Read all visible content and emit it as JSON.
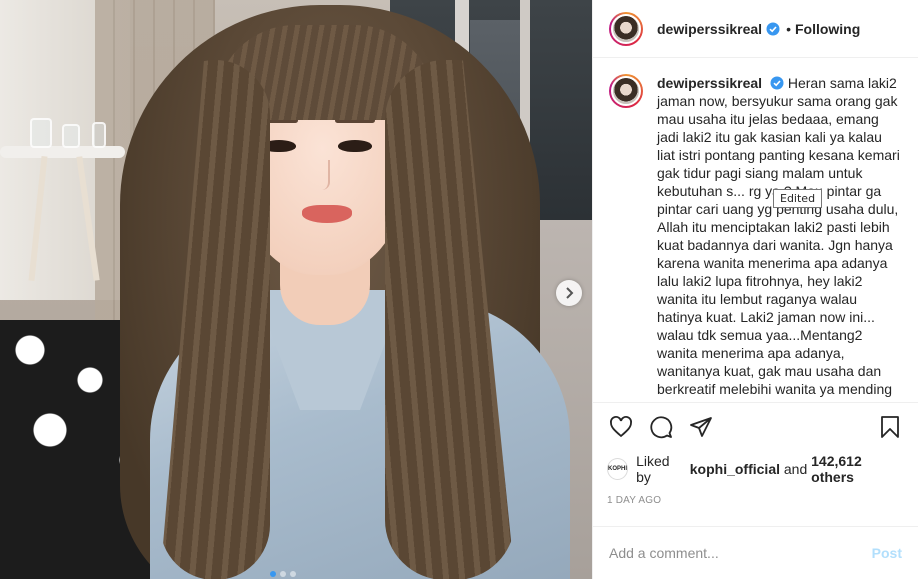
{
  "post": {
    "username": "dewiperssikreal",
    "follow_state": "Following",
    "bullet": "•",
    "caption_username": "dewiperssikreal",
    "caption": "Heran sama laki2 jaman now, bersyukur sama orang gak mau usaha itu jelas bedaaa, emang jadi laki2 itu gak kasian kali ya kalau liat istri pontang panting kesana kemari gak tidur pagi siang malam untuk kebutuhan s... rg ya ? Mau pintar ga pintar cari uang yg penting usaha dulu, Allah itu menciptakan laki2 pasti lebih kuat badannya dari wanita. Jgn hanya karena wanita menerima apa adanya lalu laki2 lupa fitrohnya, hey laki2 wanita itu lembut raganya walau hatinya kuat. Laki2 jaman now ini... walau tdk semua yaa...Mentang2 wanita menerima apa adanya, wanitanya kuat, gak mau usaha dan berkreatif melebihi wanita ya mending saran pake rok aja... gak",
    "tooltip": "Edited",
    "liked_by_prefix": "Liked by ",
    "liked_by_user": "kophi_official",
    "liked_by_middle": " and ",
    "liked_by_count": "142,612 others",
    "liker_avatar_label": "KOPHI",
    "time_ago": "1 DAY AGO",
    "comment_placeholder": "Add a comment...",
    "post_button": "Post"
  },
  "carousel": {
    "slide_count": 3,
    "active_index": 0
  },
  "icons": {
    "verified": "verified-badge-icon",
    "like": "heart-icon",
    "comment": "comment-bubble-icon",
    "share": "paper-plane-icon",
    "save": "bookmark-icon",
    "next": "chevron-right-icon"
  },
  "colors": {
    "verified": "#3897f0",
    "post_button_disabled": "#b2dffc",
    "muted_text": "#8e8e8e",
    "active_dot": "#3897f0"
  }
}
